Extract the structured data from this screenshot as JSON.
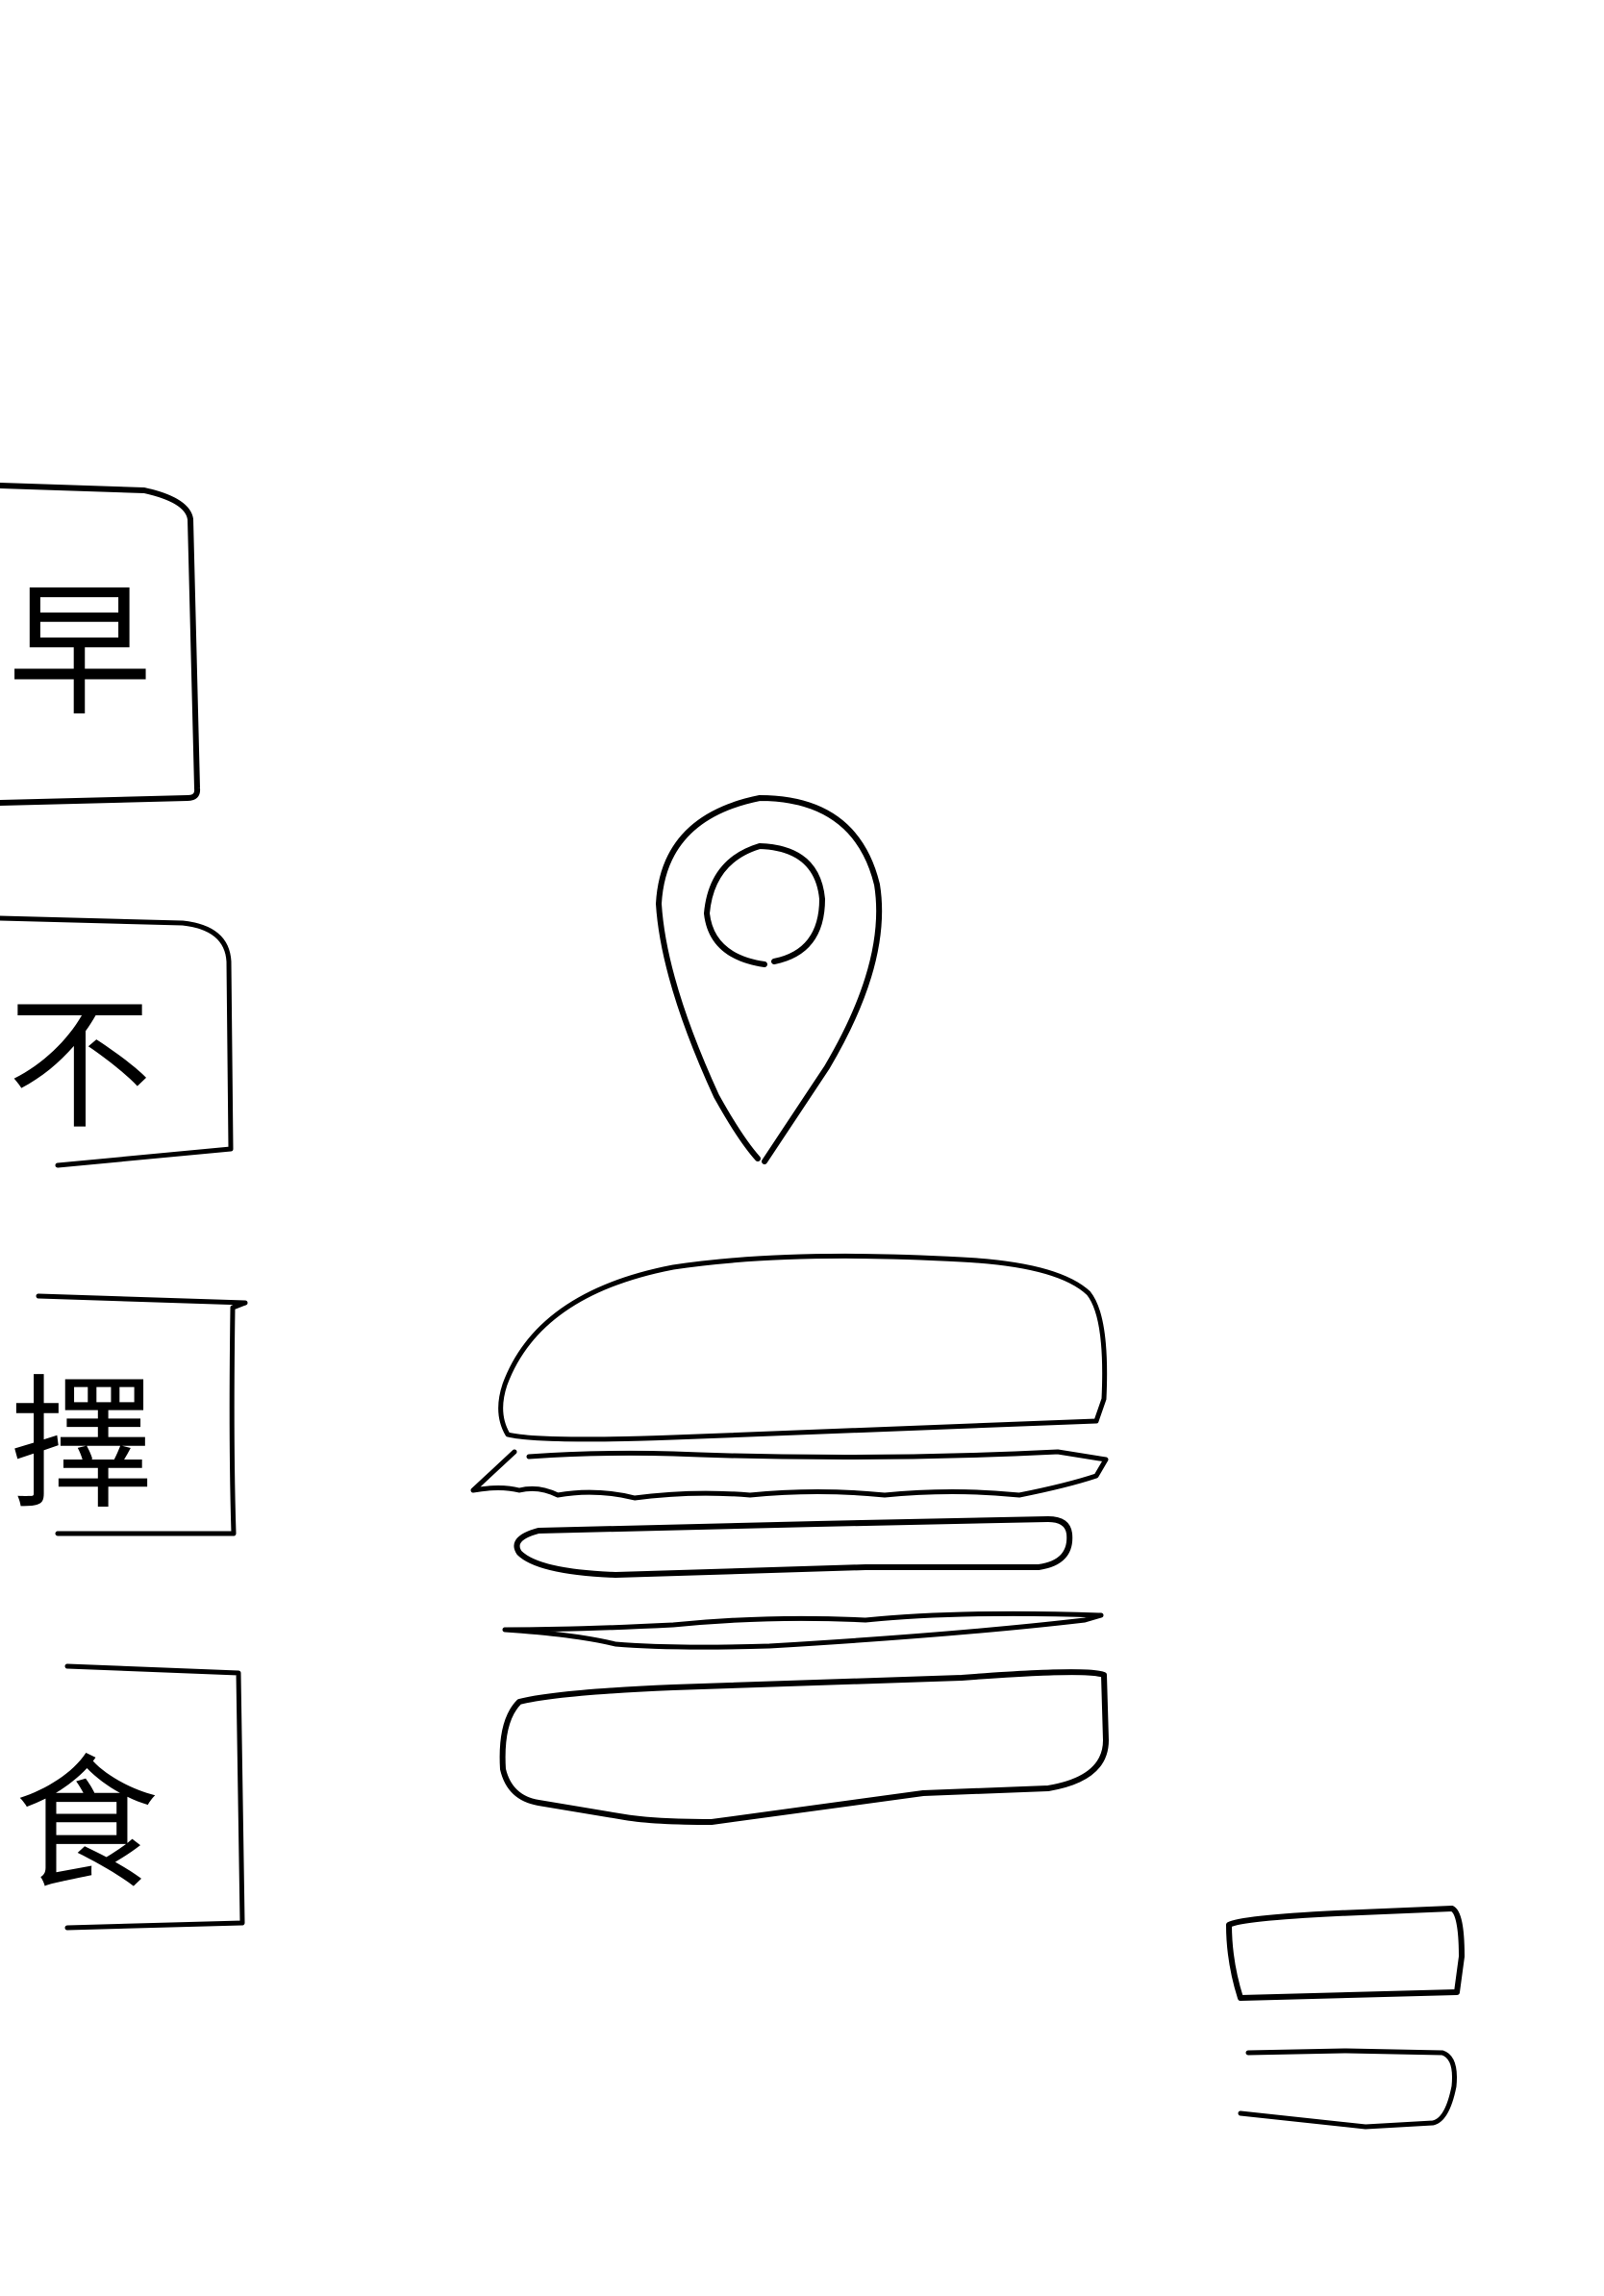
{
  "screen": {
    "type": "hand-drawn sketch",
    "stroke_color": "#000000",
    "background_color": "#ffffff"
  },
  "side_tabs": [
    {
      "label": "早"
    },
    {
      "label": "不"
    },
    {
      "label": "擇"
    },
    {
      "label": "食"
    }
  ],
  "icons": {
    "location": "map-pin-icon",
    "food": "hamburger-icon",
    "menu": "menu-icon"
  }
}
